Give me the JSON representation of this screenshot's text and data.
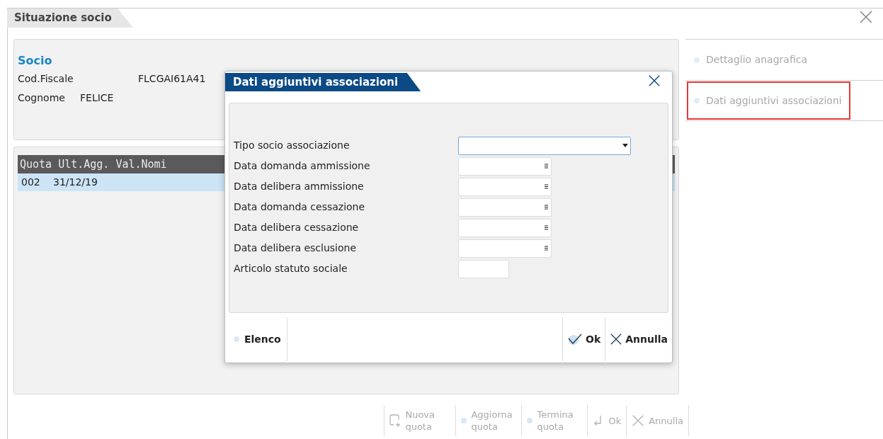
{
  "window": {
    "title": "Situazione socio"
  },
  "socio": {
    "heading": "Socio",
    "fields": [
      {
        "label": "Cod.Fiscale",
        "value": "FLCGAI61A41"
      },
      {
        "label": "Cognome",
        "value": "FELICE"
      }
    ]
  },
  "table": {
    "columns": [
      "Quota",
      "Ult.Agg.",
      "Val.Nomi"
    ],
    "rows": [
      {
        "cells": [
          "002",
          "31/12/19"
        ],
        "selected": true
      }
    ]
  },
  "side_items": [
    {
      "label": "Dettaglio anagrafica",
      "highlighted": false,
      "disabled": true
    },
    {
      "label": "Dati aggiuntivi associazioni",
      "highlighted": true,
      "disabled": true
    }
  ],
  "toolbar": [
    {
      "kind": "new",
      "label": "Nuova quota",
      "disabled": true
    },
    {
      "kind": "dot",
      "label": "Aggiorna quota",
      "disabled": true
    },
    {
      "kind": "dot",
      "label": "Termina quota",
      "disabled": true
    },
    {
      "kind": "enter",
      "label": "Ok",
      "disabled": true
    },
    {
      "kind": "cancel",
      "label": "Annulla",
      "disabled": true
    }
  ],
  "dialog": {
    "title": "Dati aggiuntivi associazioni",
    "fields": [
      {
        "kind": "select",
        "label": "Tipo socio associazione",
        "focused": true
      },
      {
        "kind": "date",
        "label": "Data domanda ammissione",
        "focused": false
      },
      {
        "kind": "date",
        "label": "Data delibera ammissione",
        "focused": false
      },
      {
        "kind": "date",
        "label": "Data domanda cessazione",
        "focused": false
      },
      {
        "kind": "date",
        "label": "Data delibera cessazione",
        "focused": false
      },
      {
        "kind": "date",
        "label": "Data delibera esclusione",
        "focused": false
      },
      {
        "kind": "text",
        "label": "Articolo statuto sociale",
        "focused": false
      }
    ],
    "left_buttons": [
      {
        "kind": "dot",
        "label": "Elenco"
      }
    ],
    "right_buttons": [
      {
        "kind": "check",
        "label": "Ok"
      },
      {
        "kind": "cancel",
        "label": "Annulla"
      }
    ]
  }
}
